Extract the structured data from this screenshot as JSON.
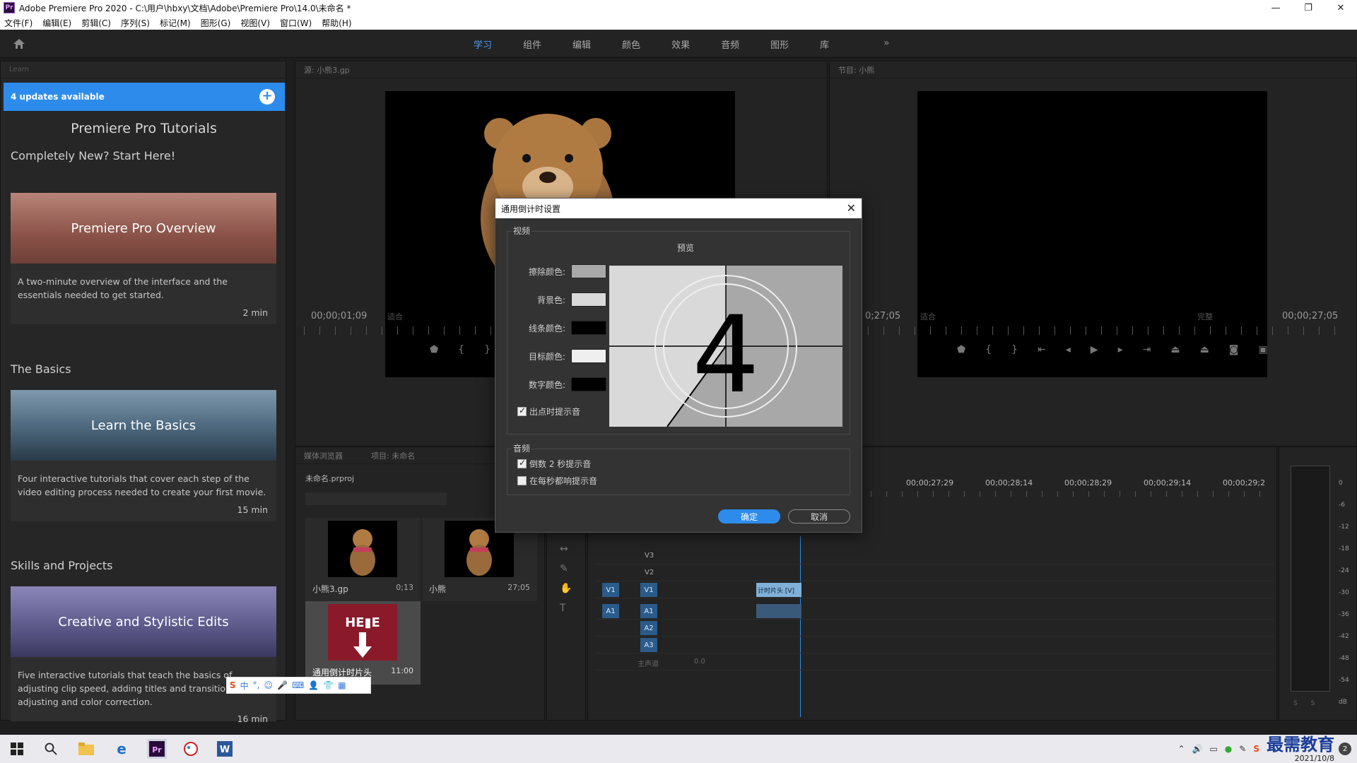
{
  "window": {
    "app_icon": "Pr",
    "title": "Adobe Premiere Pro 2020 - C:\\用户\\hbxy\\文档\\Adobe\\Premiere Pro\\14.0\\未命名 *",
    "controls": [
      "—",
      "❐",
      "✕"
    ]
  },
  "menu": [
    "文件(F)",
    "编辑(E)",
    "剪辑(C)",
    "序列(S)",
    "标记(M)",
    "图形(G)",
    "视图(V)",
    "窗口(W)",
    "帮助(H)"
  ],
  "workspaces": {
    "tabs": [
      "学习",
      "组件",
      "编辑",
      "颜色",
      "效果",
      "音频",
      "图形",
      "库"
    ],
    "active": "学习",
    "more": "»"
  },
  "learn": {
    "panel_title": "Learn",
    "updates": "4 updates available",
    "plus": "+",
    "heading": "Premiere Pro Tutorials",
    "sections": [
      {
        "title": "Completely New? Start Here!",
        "card_title": "Premiere Pro Overview",
        "desc": "A two-minute overview of the interface and the essentials needed to get started.",
        "duration": "2 min"
      },
      {
        "title": "The Basics",
        "card_title": "Learn the Basics",
        "desc": "Four interactive tutorials that cover each step of the video editing process needed to create your first movie.",
        "duration": "15 min"
      },
      {
        "title": "Skills and Projects",
        "card_title": "Creative and Stylistic Edits",
        "desc": "Five interactive tutorials that teach the basics of adjusting clip speed, adding titles and transitions, adjusting and color correction.",
        "duration": "16 min"
      }
    ]
  },
  "source": {
    "title": "源: 小熊3.gp",
    "timecode": "00;00;01;09",
    "fit": "适合"
  },
  "program": {
    "title": "节目: 小熊",
    "timecode_left": "0;27;05",
    "fit": "适合",
    "quality": "完整",
    "timecode_right": "00;00;27;05"
  },
  "project": {
    "tabs": [
      "媒体浏览器",
      "项目: 未命名"
    ],
    "file": "未命名.prproj",
    "items": [
      {
        "name": "小熊3.gp",
        "duration": "0;13"
      },
      {
        "name": "小熊",
        "duration": "27;05"
      },
      {
        "name": "通用倒计时片头",
        "duration": "11:00"
      }
    ]
  },
  "timeline": {
    "times": [
      "00;00;27;29",
      "00;00;28;14",
      "00;00;28;29",
      "00;00;29;14",
      "00;00;29;2"
    ],
    "tracks_video": [
      "V3",
      "V2",
      "V1"
    ],
    "tracks_audio": [
      "A1",
      "A2",
      "A3"
    ],
    "master": "主声道",
    "master_value": "0.0",
    "clip_label": "计时片头 [V]",
    "src_v": "V1",
    "src_a": "A1"
  },
  "meter": {
    "scale": [
      "0",
      "-6",
      "-12",
      "-18",
      "-24",
      "-30",
      "-36",
      "-42",
      "-48",
      "-54",
      "dB"
    ],
    "solo": [
      "S",
      "S"
    ]
  },
  "dialog": {
    "title": "通用倒计时设置",
    "video_label": "视频",
    "preview_label": "预览",
    "colors": [
      {
        "label": "擦除颜色:",
        "color": "#a8a8a8"
      },
      {
        "label": "背景色:",
        "color": "#d9d9d9"
      },
      {
        "label": "线条颜色:",
        "color": "#000000"
      },
      {
        "label": "目标颜色:",
        "color": "#efefef"
      },
      {
        "label": "数字颜色:",
        "color": "#000000"
      }
    ],
    "cue_out": "出点时提示音",
    "audio_label": "音频",
    "cue_2sec": "倒数 2 秒提示音",
    "cue_each": "在每秒都响提示音",
    "preview_digit": "4",
    "ok": "确定",
    "cancel": "取消"
  },
  "ime": [
    "中",
    "°,",
    "☺",
    "🎤",
    "⌨",
    "👤",
    "👕",
    "▦"
  ],
  "taskbar": {
    "date": "2021/10/8",
    "watermark": "最需教育",
    "badge": "2"
  }
}
